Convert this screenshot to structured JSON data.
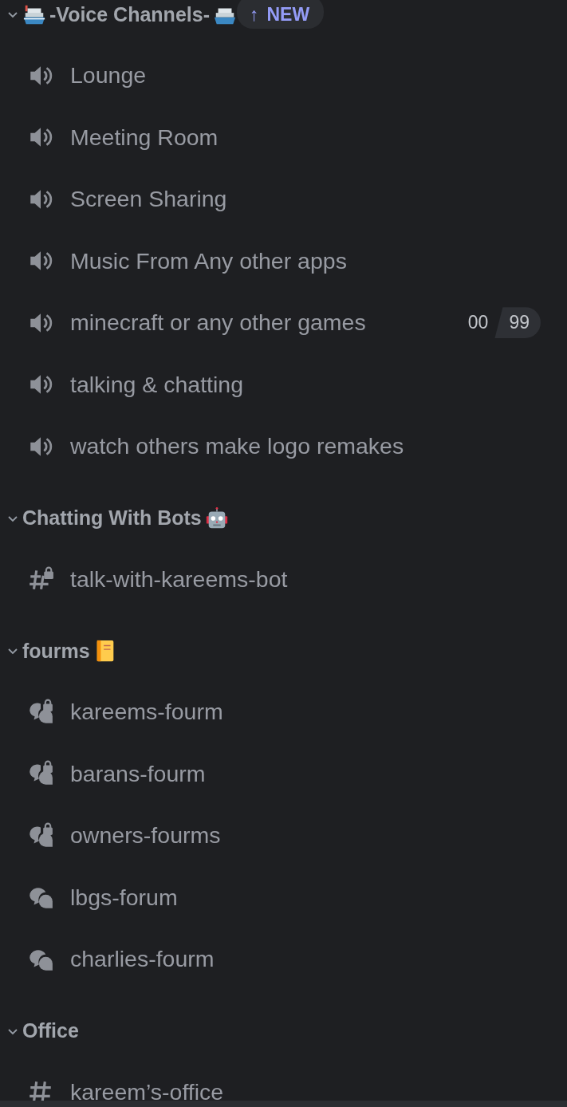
{
  "new_pill": {
    "arrow": "↑",
    "label": "NEW"
  },
  "categories": [
    {
      "name": "-Voice Channels-",
      "expanded": true,
      "channels": [
        {
          "kind": "voice",
          "name": "Lounge"
        },
        {
          "kind": "voice",
          "name": "Meeting Room"
        },
        {
          "kind": "voice",
          "name": "Screen Sharing"
        },
        {
          "kind": "voice",
          "name": "Music From Any other apps"
        },
        {
          "kind": "voice",
          "name": "minecraft or any other games",
          "user_count": "00",
          "user_limit": "99"
        },
        {
          "kind": "voice",
          "name": "talking & chatting"
        },
        {
          "kind": "voice",
          "name": "watch others make logo remakes"
        }
      ]
    },
    {
      "name": "Chatting With Bots",
      "expanded": true,
      "channels": [
        {
          "kind": "text-locked",
          "name": "talk-with-kareems-bot"
        }
      ]
    },
    {
      "name": "fourms",
      "expanded": true,
      "channels": [
        {
          "kind": "forum-locked",
          "name": "kareems-fourm"
        },
        {
          "kind": "forum-locked",
          "name": "barans-fourm"
        },
        {
          "kind": "forum-locked",
          "name": "owners-fourms"
        },
        {
          "kind": "forum",
          "name": "lbgs-forum"
        },
        {
          "kind": "forum",
          "name": "charlies-fourm"
        }
      ]
    },
    {
      "name": "Office",
      "expanded": true,
      "channels": [
        {
          "kind": "text",
          "name": "kareem’s-office"
        }
      ]
    }
  ]
}
